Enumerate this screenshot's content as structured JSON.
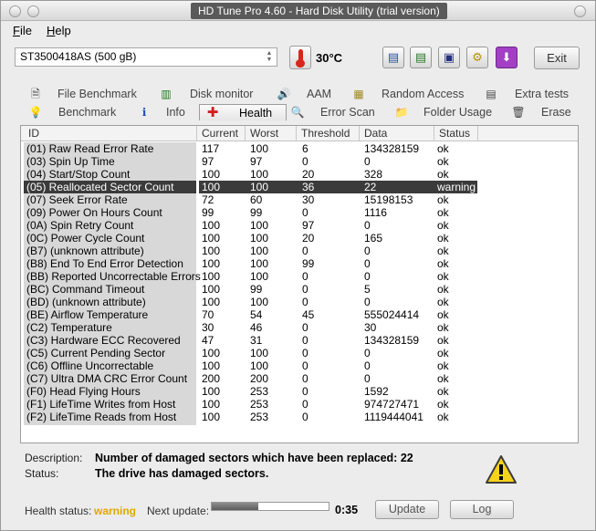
{
  "window": {
    "title": "HD Tune Pro 4.60 - Hard Disk Utility (trial version)"
  },
  "menu": [
    {
      "accel": "F",
      "rest": "ile"
    },
    {
      "accel": "H",
      "rest": "elp"
    }
  ],
  "toolbar": {
    "drive": "ST3500418AS (500 gB)",
    "temperature": "30°C",
    "exit_label": "Exit",
    "icons": [
      "copy-info-icon",
      "copy-text-icon",
      "save-icon",
      "options-icon",
      "download-icon"
    ]
  },
  "tabs_top": [
    {
      "label": "File Benchmark",
      "icon": "file-benchmark-icon",
      "glyph": "🗎"
    },
    {
      "label": "Disk monitor",
      "icon": "disk-monitor-icon",
      "glyph": "▥"
    },
    {
      "label": "AAM",
      "icon": "speaker-icon",
      "glyph": "🔊"
    },
    {
      "label": "Random Access",
      "icon": "random-access-icon",
      "glyph": "▦"
    },
    {
      "label": "Extra tests",
      "icon": "extra-tests-icon",
      "glyph": "▤"
    }
  ],
  "tabs_bottom": [
    {
      "label": "Benchmark",
      "icon": "lightbulb-icon",
      "glyph": "💡"
    },
    {
      "label": "Info",
      "icon": "info-icon",
      "glyph": "ℹ"
    },
    {
      "label": "Health",
      "icon": "health-cross-icon",
      "glyph": "✚"
    },
    {
      "label": "Error Scan",
      "icon": "magnifier-icon",
      "glyph": "🔍"
    },
    {
      "label": "Folder Usage",
      "icon": "folder-icon",
      "glyph": "📁"
    },
    {
      "label": "Erase",
      "icon": "trash-icon",
      "glyph": "🗑"
    }
  ],
  "table": {
    "columns": [
      "ID",
      "Current",
      "Worst",
      "Threshold",
      "Data",
      "Status"
    ],
    "rows": [
      [
        "(01) Raw Read Error Rate",
        "117",
        "100",
        "6",
        "134328159",
        "ok"
      ],
      [
        "(03) Spin Up Time",
        "97",
        "97",
        "0",
        "0",
        "ok"
      ],
      [
        "(04) Start/Stop Count",
        "100",
        "100",
        "20",
        "328",
        "ok"
      ],
      [
        "(05) Reallocated Sector Count",
        "100",
        "100",
        "36",
        "22",
        "warning"
      ],
      [
        "(07) Seek Error Rate",
        "72",
        "60",
        "30",
        "15198153",
        "ok"
      ],
      [
        "(09) Power On Hours Count",
        "99",
        "99",
        "0",
        "1116",
        "ok"
      ],
      [
        "(0A) Spin Retry Count",
        "100",
        "100",
        "97",
        "0",
        "ok"
      ],
      [
        "(0C) Power Cycle Count",
        "100",
        "100",
        "20",
        "165",
        "ok"
      ],
      [
        "(B7) (unknown attribute)",
        "100",
        "100",
        "0",
        "0",
        "ok"
      ],
      [
        "(B8) End To End Error Detection",
        "100",
        "100",
        "99",
        "0",
        "ok"
      ],
      [
        "(BB) Reported Uncorrectable Errors",
        "100",
        "100",
        "0",
        "0",
        "ok"
      ],
      [
        "(BC) Command Timeout",
        "100",
        "99",
        "0",
        "5",
        "ok"
      ],
      [
        "(BD) (unknown attribute)",
        "100",
        "100",
        "0",
        "0",
        "ok"
      ],
      [
        "(BE) Airflow Temperature",
        "70",
        "54",
        "45",
        "555024414",
        "ok"
      ],
      [
        "(C2) Temperature",
        "30",
        "46",
        "0",
        "30",
        "ok"
      ],
      [
        "(C3) Hardware ECC Recovered",
        "47",
        "31",
        "0",
        "134328159",
        "ok"
      ],
      [
        "(C5) Current Pending Sector",
        "100",
        "100",
        "0",
        "0",
        "ok"
      ],
      [
        "(C6) Offline Uncorrectable",
        "100",
        "100",
        "0",
        "0",
        "ok"
      ],
      [
        "(C7) Ultra DMA CRC Error Count",
        "200",
        "200",
        "0",
        "0",
        "ok"
      ],
      [
        "(F0) Head Flying Hours",
        "100",
        "253",
        "0",
        "1592",
        "ok"
      ],
      [
        "(F1) LifeTime Writes from Host",
        "100",
        "253",
        "0",
        "974727471",
        "ok"
      ],
      [
        "(F2) LifeTime Reads from Host",
        "100",
        "253",
        "0",
        "1119444041",
        "ok"
      ]
    ]
  },
  "details": {
    "description_label": "Description:",
    "description": "Number of damaged sectors which have been replaced: 22",
    "status_label": "Status:",
    "status": "The drive has damaged sectors."
  },
  "footer": {
    "health_label": "Health status:",
    "health_value": "warning",
    "next_update_label": "Next update:",
    "next_update_progress": 0.4,
    "countdown": "0:35",
    "update_label": "Update",
    "log_label": "Log"
  }
}
